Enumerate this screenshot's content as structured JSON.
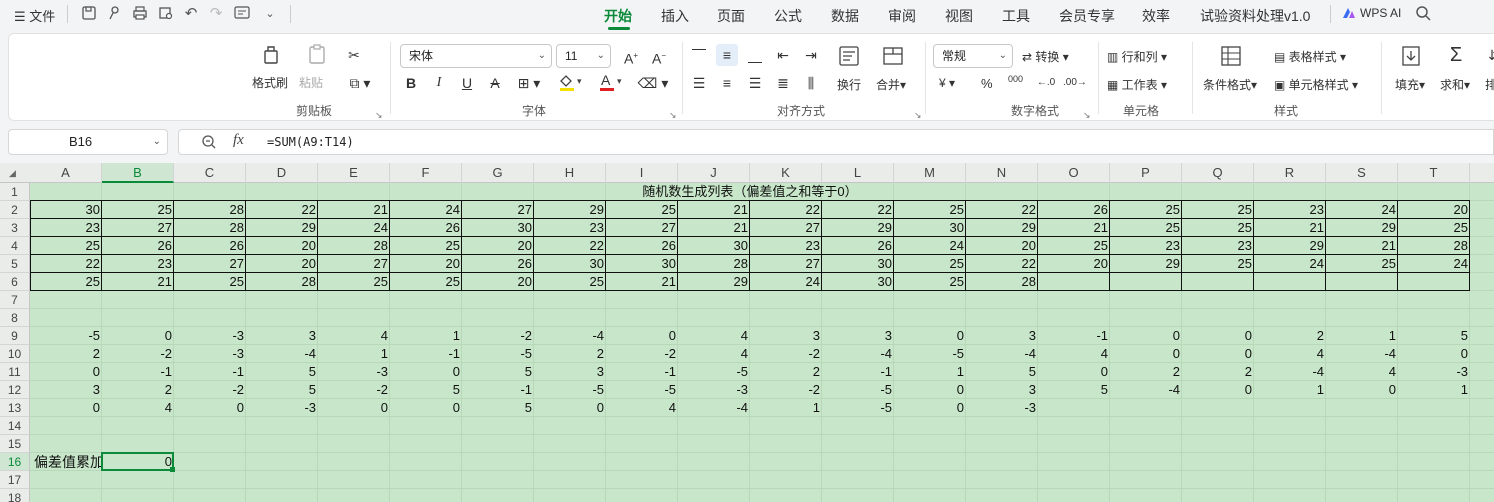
{
  "menubar": {
    "menu_label": "☰ 文件",
    "tabs": [
      "开始",
      "插入",
      "页面",
      "公式",
      "数据",
      "审阅",
      "视图",
      "工具",
      "会员专享",
      "效率",
      "试验资料处理v1.0"
    ],
    "active_tab": "开始",
    "ai_label": "WPS AI"
  },
  "ribbon": {
    "clipboard": {
      "format_painter": "格式刷",
      "paste": "粘贴",
      "label": "剪贴板"
    },
    "font": {
      "name": "宋体",
      "size": "11",
      "label": "字体"
    },
    "alignment": {
      "wrap": "换行",
      "merge": "合并",
      "label": "对齐方式"
    },
    "number": {
      "format": "常规",
      "convert": "转换",
      "currency": "¥",
      "percent": "%",
      "thousands": "000",
      "label": "数字格式"
    },
    "cells": {
      "rows_cols": "行和列",
      "worksheet": "工作表",
      "label": "单元格"
    },
    "styles": {
      "conditional": "条件格式",
      "table_style": "表格样式",
      "cell_style": "单元格样式",
      "label": "样式"
    },
    "editing": {
      "fill": "填充",
      "sum": "求和",
      "more": "排"
    }
  },
  "formula_bar": {
    "cell_ref": "B16",
    "fx": "fx",
    "formula": "=SUM(A9:T14)"
  },
  "sheet": {
    "columns": [
      "A",
      "B",
      "C",
      "D",
      "E",
      "F",
      "G",
      "H",
      "I",
      "J",
      "K",
      "L",
      "M",
      "N",
      "O",
      "P",
      "Q",
      "R",
      "S",
      "T"
    ],
    "rows": [
      "1",
      "2",
      "3",
      "4",
      "5",
      "6",
      "7",
      "8",
      "9",
      "10",
      "11",
      "12",
      "13",
      "14",
      "15",
      "16",
      "17",
      "18"
    ],
    "selected_column": "B",
    "selected_row": "16",
    "title": "随机数生成列表（偏差值之和等于0）",
    "data_rows": [
      [
        "30",
        "25",
        "28",
        "22",
        "21",
        "24",
        "27",
        "29",
        "25",
        "21",
        "22",
        "22",
        "25",
        "22",
        "26",
        "25",
        "25",
        "23",
        "24",
        "20"
      ],
      [
        "23",
        "27",
        "28",
        "29",
        "24",
        "26",
        "30",
        "23",
        "27",
        "21",
        "27",
        "29",
        "30",
        "29",
        "21",
        "25",
        "25",
        "21",
        "29",
        "25"
      ],
      [
        "25",
        "26",
        "26",
        "20",
        "28",
        "25",
        "20",
        "22",
        "26",
        "30",
        "23",
        "26",
        "24",
        "20",
        "25",
        "23",
        "23",
        "29",
        "21",
        "28"
      ],
      [
        "22",
        "23",
        "27",
        "20",
        "27",
        "20",
        "26",
        "30",
        "30",
        "28",
        "27",
        "30",
        "25",
        "22",
        "20",
        "29",
        "25",
        "24",
        "25",
        "24"
      ],
      [
        "25",
        "21",
        "25",
        "28",
        "25",
        "25",
        "20",
        "25",
        "21",
        "29",
        "24",
        "30",
        "25",
        "28",
        "",
        "",
        "",
        "",
        "",
        ""
      ]
    ],
    "deviation_rows": [
      [
        "-5",
        "0",
        "-3",
        "3",
        "4",
        "1",
        "-2",
        "-4",
        "0",
        "4",
        "3",
        "3",
        "0",
        "3",
        "-1",
        "0",
        "0",
        "2",
        "1",
        "5"
      ],
      [
        "2",
        "-2",
        "-3",
        "-4",
        "1",
        "-1",
        "-5",
        "2",
        "-2",
        "4",
        "-2",
        "-4",
        "-5",
        "-4",
        "4",
        "0",
        "0",
        "4",
        "-4",
        "0"
      ],
      [
        "0",
        "-1",
        "-1",
        "5",
        "-3",
        "0",
        "5",
        "3",
        "-1",
        "-5",
        "2",
        "-1",
        "1",
        "5",
        "0",
        "2",
        "2",
        "-4",
        "4",
        "-3"
      ],
      [
        "3",
        "2",
        "-2",
        "5",
        "-2",
        "5",
        "-1",
        "-5",
        "-5",
        "-3",
        "-2",
        "-5",
        "0",
        "3",
        "5",
        "-4",
        "0",
        "1",
        "0",
        "1"
      ],
      [
        "0",
        "4",
        "0",
        "-3",
        "0",
        "0",
        "5",
        "0",
        "4",
        "-4",
        "1",
        "-5",
        "0",
        "-3",
        "",
        "",
        "",
        "",
        "",
        ""
      ]
    ],
    "sum_label": "偏差值累加",
    "sum_value": "0"
  },
  "colors": {
    "accent": "#0b8a3a",
    "sheet_bg": "#c8e6c9"
  }
}
